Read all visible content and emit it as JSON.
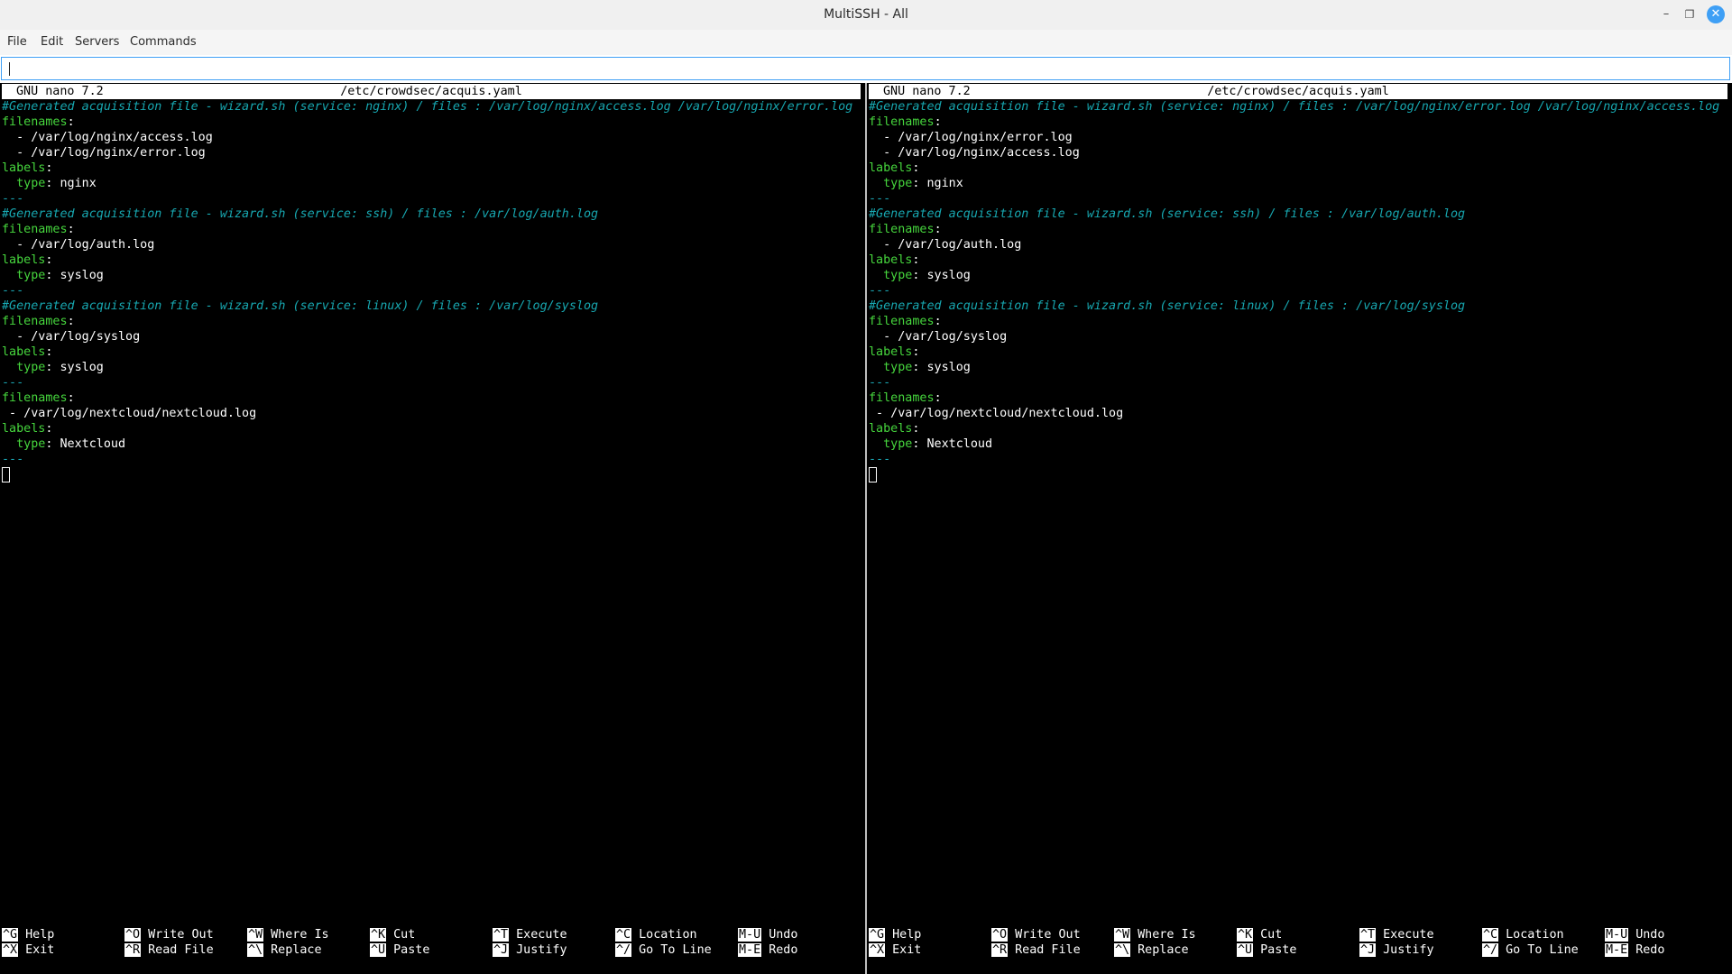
{
  "window": {
    "title": "MultiSSH - All",
    "controls": {
      "minimize": "–",
      "maximize": "❐",
      "close": "✕"
    }
  },
  "menu": [
    "File",
    "Edit",
    "Servers",
    "Commands"
  ],
  "command_input": {
    "value": ""
  },
  "panes": [
    {
      "nano_version": "GNU nano 7.2",
      "filename": "/etc/crowdsec/acquis.yaml",
      "lines": [
        [
          {
            "t": "#Generated acquisition file - wizard.sh (service: nginx) / files : /var/log/nginx/access.log /var/log/nginx/error.log",
            "c": "comment"
          }
        ],
        [
          {
            "t": "filenames",
            "c": "key"
          },
          {
            "t": ":",
            "c": "plain"
          }
        ],
        [
          {
            "t": "  - /var/log/nginx/access.log",
            "c": "plain"
          }
        ],
        [
          {
            "t": "  - /var/log/nginx/error.log",
            "c": "plain"
          }
        ],
        [
          {
            "t": "labels",
            "c": "key"
          },
          {
            "t": ":",
            "c": "plain"
          }
        ],
        [
          {
            "t": "  type",
            "c": "key"
          },
          {
            "t": ": nginx",
            "c": "plain"
          }
        ],
        [
          {
            "t": "---",
            "c": "sep"
          }
        ],
        [
          {
            "t": "#Generated acquisition file - wizard.sh (service: ssh) / files : /var/log/auth.log",
            "c": "comment"
          }
        ],
        [
          {
            "t": "filenames",
            "c": "key"
          },
          {
            "t": ":",
            "c": "plain"
          }
        ],
        [
          {
            "t": "  - /var/log/auth.log",
            "c": "plain"
          }
        ],
        [
          {
            "t": "labels",
            "c": "key"
          },
          {
            "t": ":",
            "c": "plain"
          }
        ],
        [
          {
            "t": "  type",
            "c": "key"
          },
          {
            "t": ": syslog",
            "c": "plain"
          }
        ],
        [
          {
            "t": "---",
            "c": "sep"
          }
        ],
        [
          {
            "t": "#Generated acquisition file - wizard.sh (service: linux) / files : /var/log/syslog",
            "c": "comment"
          }
        ],
        [
          {
            "t": "filenames",
            "c": "key"
          },
          {
            "t": ":",
            "c": "plain"
          }
        ],
        [
          {
            "t": "  - /var/log/syslog",
            "c": "plain"
          }
        ],
        [
          {
            "t": "labels",
            "c": "key"
          },
          {
            "t": ":",
            "c": "plain"
          }
        ],
        [
          {
            "t": "  type",
            "c": "key"
          },
          {
            "t": ": syslog",
            "c": "plain"
          }
        ],
        [
          {
            "t": "---",
            "c": "sep"
          }
        ],
        [
          {
            "t": "filenames",
            "c": "key"
          },
          {
            "t": ":",
            "c": "plain"
          }
        ],
        [
          {
            "t": " - /var/log/nextcloud/nextcloud.log",
            "c": "plain"
          }
        ],
        [
          {
            "t": "labels",
            "c": "key"
          },
          {
            "t": ":",
            "c": "plain"
          }
        ],
        [
          {
            "t": "  type",
            "c": "key"
          },
          {
            "t": ": Nextcloud",
            "c": "plain"
          }
        ],
        [
          {
            "t": "---",
            "c": "sep"
          }
        ]
      ]
    },
    {
      "nano_version": "GNU nano 7.2",
      "filename": "/etc/crowdsec/acquis.yaml",
      "lines": [
        [
          {
            "t": "#Generated acquisition file - wizard.sh (service: nginx) / files : /var/log/nginx/error.log /var/log/nginx/access.log",
            "c": "comment"
          }
        ],
        [
          {
            "t": "filenames",
            "c": "key"
          },
          {
            "t": ":",
            "c": "plain"
          }
        ],
        [
          {
            "t": "  - /var/log/nginx/error.log",
            "c": "plain"
          }
        ],
        [
          {
            "t": "  - /var/log/nginx/access.log",
            "c": "plain"
          }
        ],
        [
          {
            "t": "labels",
            "c": "key"
          },
          {
            "t": ":",
            "c": "plain"
          }
        ],
        [
          {
            "t": "  type",
            "c": "key"
          },
          {
            "t": ": nginx",
            "c": "plain"
          }
        ],
        [
          {
            "t": "---",
            "c": "sep"
          }
        ],
        [
          {
            "t": "#Generated acquisition file - wizard.sh (service: ssh) / files : /var/log/auth.log",
            "c": "comment"
          }
        ],
        [
          {
            "t": "filenames",
            "c": "key"
          },
          {
            "t": ":",
            "c": "plain"
          }
        ],
        [
          {
            "t": "  - /var/log/auth.log",
            "c": "plain"
          }
        ],
        [
          {
            "t": "labels",
            "c": "key"
          },
          {
            "t": ":",
            "c": "plain"
          }
        ],
        [
          {
            "t": "  type",
            "c": "key"
          },
          {
            "t": ": syslog",
            "c": "plain"
          }
        ],
        [
          {
            "t": "---",
            "c": "sep"
          }
        ],
        [
          {
            "t": "#Generated acquisition file - wizard.sh (service: linux) / files : /var/log/syslog",
            "c": "comment"
          }
        ],
        [
          {
            "t": "filenames",
            "c": "key"
          },
          {
            "t": ":",
            "c": "plain"
          }
        ],
        [
          {
            "t": "  - /var/log/syslog",
            "c": "plain"
          }
        ],
        [
          {
            "t": "labels",
            "c": "key"
          },
          {
            "t": ":",
            "c": "plain"
          }
        ],
        [
          {
            "t": "  type",
            "c": "key"
          },
          {
            "t": ": syslog",
            "c": "plain"
          }
        ],
        [
          {
            "t": "---",
            "c": "sep"
          }
        ],
        [
          {
            "t": "filenames",
            "c": "key"
          },
          {
            "t": ":",
            "c": "plain"
          }
        ],
        [
          {
            "t": " - /var/log/nextcloud/nextcloud.log",
            "c": "plain"
          }
        ],
        [
          {
            "t": "labels",
            "c": "key"
          },
          {
            "t": ":",
            "c": "plain"
          }
        ],
        [
          {
            "t": "  type",
            "c": "key"
          },
          {
            "t": ": Nextcloud",
            "c": "plain"
          }
        ],
        [
          {
            "t": "---",
            "c": "sep"
          }
        ]
      ]
    }
  ],
  "shortcuts": [
    {
      "key": "^G",
      "label": "Help"
    },
    {
      "key": "^X",
      "label": "Exit"
    },
    {
      "key": "^O",
      "label": "Write Out"
    },
    {
      "key": "^R",
      "label": "Read File"
    },
    {
      "key": "^W",
      "label": "Where Is"
    },
    {
      "key": "^\\",
      "label": "Replace"
    },
    {
      "key": "^K",
      "label": "Cut"
    },
    {
      "key": "^U",
      "label": "Paste"
    },
    {
      "key": "^T",
      "label": "Execute"
    },
    {
      "key": "^J",
      "label": "Justify"
    },
    {
      "key": "^C",
      "label": "Location"
    },
    {
      "key": "^/",
      "label": "Go To Line"
    },
    {
      "key": "M-U",
      "label": "Undo"
    },
    {
      "key": "M-E",
      "label": "Redo"
    }
  ],
  "colors": {
    "comment": "#17a7b0",
    "key": "#46d63d",
    "separator": "#1aa3b0",
    "terminal_bg": "#000000",
    "accent": "#3e9ff5"
  }
}
